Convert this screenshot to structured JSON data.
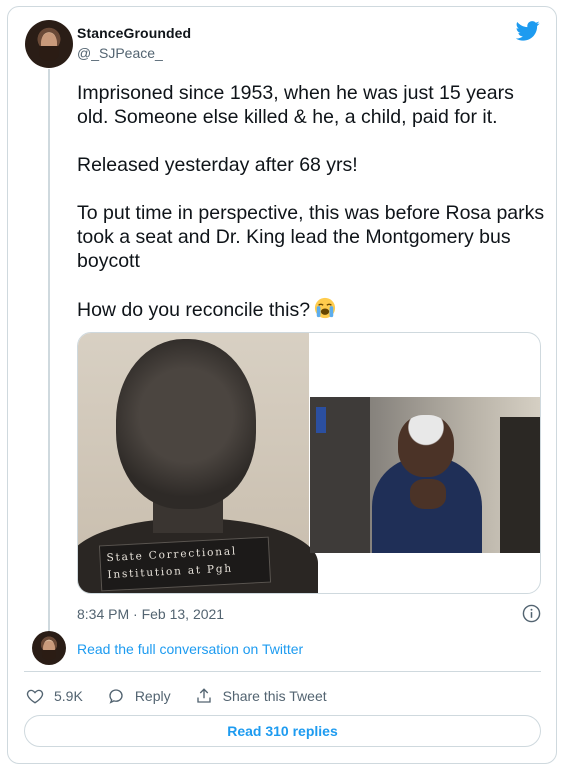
{
  "tweet": {
    "author": {
      "display_name": "StanceGrounded",
      "handle": "@_SJPeace_"
    },
    "paragraphs": [
      "Imprisoned since 1953, when he was just 15 years old. Someone else killed & he, a child, paid for it.",
      "Released yesterday after 68 yrs!",
      "To put time in perspective, this was before Rosa parks took a seat and Dr. King lead the Montgomery bus boycott",
      "How do you reconcile this?"
    ],
    "emoji": "loudly-crying-face",
    "media": {
      "left_photo_plate_line1": "State Correctional",
      "left_photo_plate_line2": "Institution at Pgh"
    },
    "timestamp": "8:34 PM · Feb 13, 2021",
    "read_conversation": "Read the full conversation on Twitter",
    "actions": {
      "likes": "5.9K",
      "reply_label": "Reply",
      "share_label": "Share this Tweet"
    },
    "read_replies": "Read 310 replies"
  },
  "colors": {
    "accent": "#1d9bf0",
    "text": "#0f1419",
    "muted": "#536471",
    "border": "#cfd9de"
  }
}
